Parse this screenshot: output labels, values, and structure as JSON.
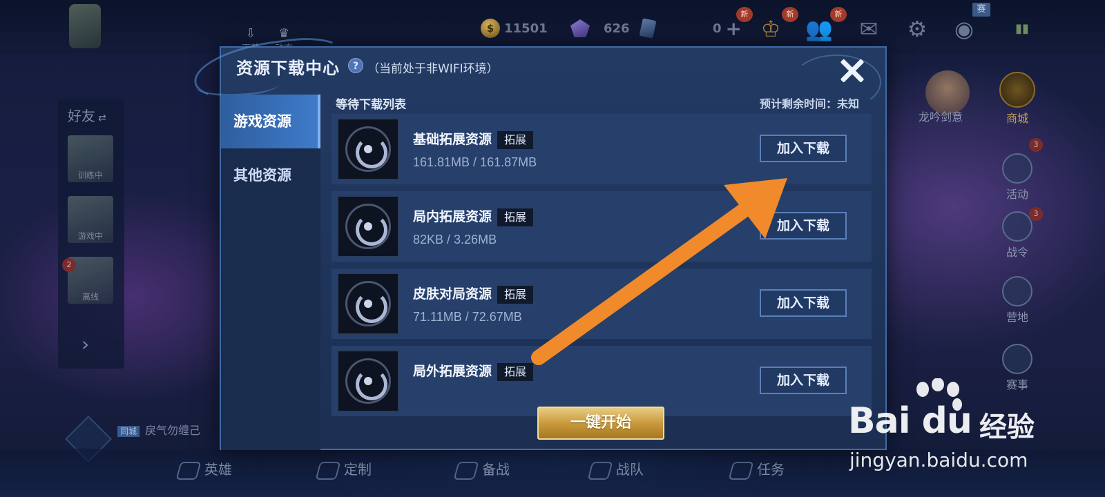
{
  "top_bar": {
    "download_label": "下载",
    "feed_label": "动态",
    "gold": "11501",
    "gems": "626",
    "vouchers": "0",
    "new_badge": "新",
    "season_badge": "赛",
    "icons": [
      "trophy-icon",
      "friends-icon",
      "mail-icon",
      "gear-icon",
      "eye-icon",
      "signal-icon"
    ]
  },
  "friends": {
    "title": "好友",
    "switch_symbol": "⇄",
    "entries": [
      {
        "status": "训练中"
      },
      {
        "status": "游戏中"
      },
      {
        "status": "离线",
        "badge": "2"
      }
    ],
    "expand_symbol": "›"
  },
  "chat": {
    "channel_tag": "同城",
    "message": "戾气勿缠己"
  },
  "right_menu": {
    "hero_name": "龙吟剑意",
    "items": [
      {
        "label": "商城",
        "badge": ""
      },
      {
        "label": "活动",
        "badge": "3"
      },
      {
        "label": "战令",
        "badge": "3"
      },
      {
        "label": "营地",
        "badge": ""
      },
      {
        "label": "赛事",
        "badge": ""
      }
    ]
  },
  "bottom_nav": {
    "items": [
      "英雄",
      "定制",
      "备战",
      "战队",
      "任务"
    ]
  },
  "dialog": {
    "title": "资源下载中心",
    "help_symbol": "?",
    "network_note": "（当前处于非WIFI环境）",
    "tabs": [
      {
        "label": "游戏资源",
        "active": true
      },
      {
        "label": "其他资源",
        "active": false
      }
    ],
    "list_header": "等待下载列表",
    "eta": "预计剩余时间：未知",
    "items": [
      {
        "name": "基础拓展资源",
        "tag": "拓展",
        "size": "161.81MB / 161.87MB",
        "button": "加入下载"
      },
      {
        "name": "局内拓展资源",
        "tag": "拓展",
        "size": "82KB / 3.26MB",
        "button": "加入下载"
      },
      {
        "name": "皮肤对局资源",
        "tag": "拓展",
        "size": "71.11MB / 72.67MB",
        "button": "加入下载"
      },
      {
        "name": "局外拓展资源",
        "tag": "拓展",
        "size": "",
        "button": "加入下载"
      }
    ],
    "start_button": "一键开始"
  },
  "annotation": {
    "arrow_color": "#f08a2a"
  },
  "watermark": {
    "brand": "Bai  du",
    "brand_suffix": "经验",
    "url": "jingyan.baidu.com"
  }
}
